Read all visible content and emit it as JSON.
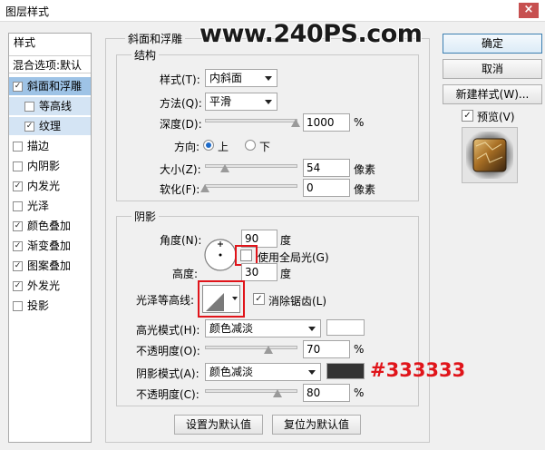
{
  "window": {
    "title": "图层样式",
    "close_label": "×"
  },
  "watermark": "www.240PS.com",
  "left_panel": {
    "items": [
      {
        "label": "样式"
      },
      {
        "label": "混合选项:默认"
      },
      {
        "label": "斜面和浮雕",
        "checked": true,
        "mark": "✓"
      },
      {
        "label": "等高线",
        "checked": false,
        "mark": ""
      },
      {
        "label": "纹理",
        "checked": true,
        "mark": "✓"
      },
      {
        "label": "描边",
        "checked": false,
        "mark": ""
      },
      {
        "label": "内阴影",
        "checked": false,
        "mark": ""
      },
      {
        "label": "内发光",
        "checked": true,
        "mark": "✓"
      },
      {
        "label": "光泽",
        "checked": false,
        "mark": ""
      },
      {
        "label": "颜色叠加",
        "checked": true,
        "mark": "✓"
      },
      {
        "label": "渐变叠加",
        "checked": true,
        "mark": "✓"
      },
      {
        "label": "图案叠加",
        "checked": true,
        "mark": "✓"
      },
      {
        "label": "外发光",
        "checked": true,
        "mark": "✓"
      },
      {
        "label": "投影",
        "checked": false,
        "mark": ""
      }
    ]
  },
  "bevel": {
    "section_title": "斜面和浮雕",
    "structure": {
      "title": "结构",
      "style_label": "样式(T):",
      "style_value": "内斜面",
      "technique_label": "方法(Q):",
      "technique_value": "平滑",
      "depth_label": "深度(D):",
      "depth_value": "1000",
      "depth_unit": "%",
      "depth_fraction": 1.0,
      "direction_label": "方向:",
      "direction_up": "上",
      "direction_down": "下",
      "size_label": "大小(Z):",
      "size_value": "54",
      "size_unit": "像素",
      "size_fraction": 0.22,
      "soften_label": "软化(F):",
      "soften_value": "0",
      "soften_unit": "像素",
      "soften_fraction": 0.0
    },
    "shading": {
      "title": "阴影",
      "angle_label": "角度(N):",
      "angle_value": "90",
      "angle_unit": "度",
      "global_light_label": "使用全局光(G)",
      "altitude_label": "高度:",
      "altitude_value": "30",
      "altitude_unit": "度",
      "gloss_contour_label": "光泽等高线:",
      "antialias_label": "消除锯齿(L)",
      "antialias_mark": "✓",
      "highlight_mode_label": "高光模式(H):",
      "highlight_mode_value": "颜色减淡",
      "highlight_color": "#ffffff",
      "highlight_opacity_label": "不透明度(O):",
      "highlight_opacity_value": "70",
      "highlight_opacity_unit": "%",
      "highlight_opacity_fraction": 0.7,
      "shadow_mode_label": "阴影模式(A):",
      "shadow_mode_value": "颜色减淡",
      "shadow_color": "#333333",
      "shadow_opacity_label": "不透明度(C):",
      "shadow_opacity_value": "80",
      "shadow_opacity_unit": "%",
      "shadow_opacity_fraction": 0.8
    },
    "make_default_label": "设置为默认值",
    "reset_default_label": "复位为默认值"
  },
  "annotation": {
    "shadow_color_hex": "#333333"
  },
  "right_panel": {
    "ok_label": "确定",
    "cancel_label": "取消",
    "new_style_label": "新建样式(W)...",
    "preview_label": "预览(V)",
    "preview_mark": "✓"
  }
}
